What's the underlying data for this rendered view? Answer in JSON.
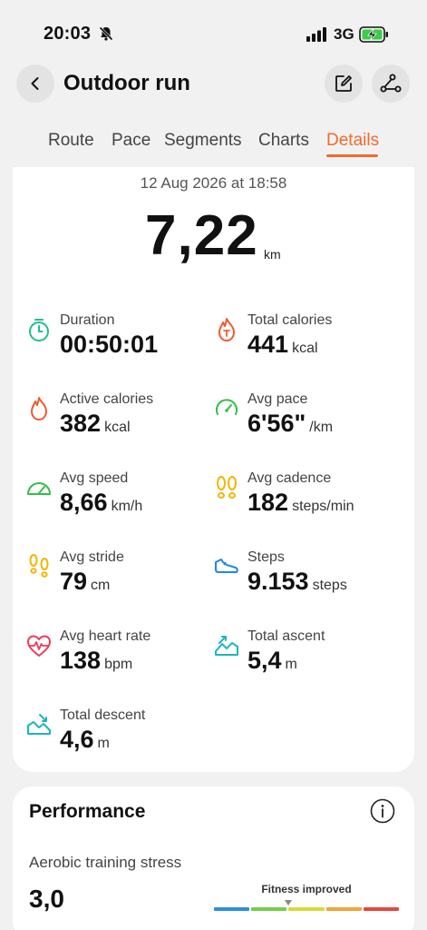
{
  "status_bar": {
    "time": "20:03",
    "network": "3G"
  },
  "header": {
    "title": "Outdoor run"
  },
  "tabs": [
    {
      "label": "Route"
    },
    {
      "label": "Pace"
    },
    {
      "label": "Segments"
    },
    {
      "label": "Charts"
    },
    {
      "label": "Details"
    }
  ],
  "active_tab": "Details",
  "summary": {
    "date": "12 Aug 2026 at 18:58",
    "distance": "7,22",
    "distance_unit": "km"
  },
  "metrics": [
    {
      "label": "Duration",
      "value": "00:50:01",
      "unit": "",
      "icon": "stopwatch-icon",
      "color": "#1fbf8f"
    },
    {
      "label": "Total calories",
      "value": "441",
      "unit": "kcal",
      "icon": "total-calories-flame-icon",
      "color": "#f2592f"
    },
    {
      "label": "Active calories",
      "value": "382",
      "unit": "kcal",
      "icon": "flame-icon",
      "color": "#f2592f"
    },
    {
      "label": "Avg pace",
      "value": "6'56\"",
      "unit": "/km",
      "icon": "pace-gauge-icon",
      "color": "#2fbf4a"
    },
    {
      "label": "Avg speed",
      "value": "8,66",
      "unit": "km/h",
      "icon": "speedometer-icon",
      "color": "#2fbf4a"
    },
    {
      "label": "Avg cadence",
      "value": "182",
      "unit": "steps/min",
      "icon": "footprints-icon",
      "color": "#f5b400"
    },
    {
      "label": "Avg stride",
      "value": "79",
      "unit": "cm",
      "icon": "stride-footprints-icon",
      "color": "#f5b400"
    },
    {
      "label": "Steps",
      "value": "9.153",
      "unit": "steps",
      "icon": "shoe-icon",
      "color": "#1e88e5"
    },
    {
      "label": "Avg heart rate",
      "value": "138",
      "unit": "bpm",
      "icon": "heart-rate-icon",
      "color": "#ef3a5d"
    },
    {
      "label": "Total ascent",
      "value": "5,4",
      "unit": "m",
      "icon": "ascent-icon",
      "color": "#1cb5c4"
    },
    {
      "label": "Total descent",
      "value": "4,6",
      "unit": "m",
      "icon": "descent-icon",
      "color": "#1cb5c4"
    }
  ],
  "performance": {
    "title": "Performance",
    "metric_label": "Aerobic training stress",
    "metric_value": "3,0",
    "status": "Fitness improved",
    "scale_colors": [
      "#2b8fe3",
      "#72cf4a",
      "#d9d93a",
      "#f0a63a",
      "#e8463c"
    ]
  }
}
